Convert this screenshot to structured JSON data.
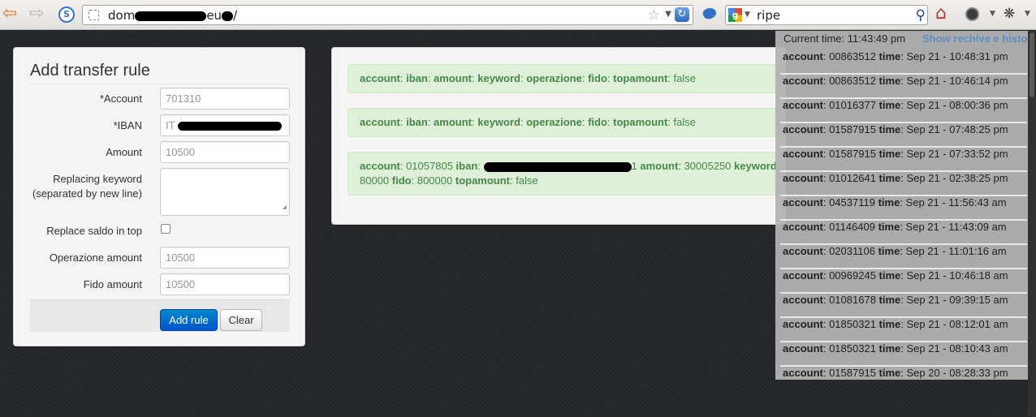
{
  "browser": {
    "url_visible_start": "dom",
    "url_visible_middle": "eu",
    "url_visible_end": "/",
    "search_query": "ripe"
  },
  "form": {
    "title": "Add transfer rule",
    "fields": [
      {
        "label": "*Account",
        "value": "701310",
        "kind": "input"
      },
      {
        "label": "*IBAN",
        "value": "IT",
        "kind": "input"
      },
      {
        "label": "Amount",
        "value": "10500",
        "kind": "input"
      },
      {
        "label_line1": "Replacing keyword",
        "label_line2": "(separated by new line)",
        "value": "",
        "kind": "textarea"
      },
      {
        "label": "Replace saldo in top",
        "checked": false,
        "kind": "checkbox"
      },
      {
        "label": "Operazione amount",
        "value": "10500",
        "kind": "input"
      },
      {
        "label": "Fido amount",
        "value": "10500",
        "kind": "input"
      }
    ],
    "add_button": "Add rule",
    "clear_button": "Clear"
  },
  "rules": [
    {
      "account": "",
      "iban": "",
      "amount": "",
      "keyword": "",
      "operazione": "",
      "fido": "",
      "topamount": "false"
    },
    {
      "account": "",
      "iban": "",
      "amount": "",
      "keyword": "",
      "operazione": "",
      "fido": "",
      "topamount": "false"
    },
    {
      "account": "01057805",
      "iban_suffix": "1",
      "amount": "30005250",
      "keyword_partial": "",
      "operazione_partial": "80000",
      "fido": "800000",
      "topamount": "false"
    }
  ],
  "labels": {
    "account": "account",
    "iban": "iban",
    "amount": "amount",
    "keyword": "keyword",
    "operazione": "operazione",
    "fido": "fido",
    "topamount": "topamount",
    "time": "time",
    "sep": ": "
  },
  "history": {
    "current_time_label": "Current time: 11:43:49 pm",
    "show_link": "Show rechive e history",
    "items": [
      {
        "account": "00863512",
        "time": "Sep 21 - 10:48:31 pm"
      },
      {
        "account": "00863512",
        "time": "Sep 21 - 10:46:14 pm"
      },
      {
        "account": "01016377",
        "time": "Sep 21 - 08:00:36 pm"
      },
      {
        "account": "01587915",
        "time": "Sep 21 - 07:48:25 pm"
      },
      {
        "account": "01587915",
        "time": "Sep 21 - 07:33:52 pm"
      },
      {
        "account": "01012641",
        "time": "Sep 21 - 02:38:25 pm"
      },
      {
        "account": "04537119",
        "time": "Sep 21 - 11:56:43 am"
      },
      {
        "account": "01146409",
        "time": "Sep 21 - 11:43:09 am"
      },
      {
        "account": "02031106",
        "time": "Sep 21 - 11:01:16 am"
      },
      {
        "account": "00969245",
        "time": "Sep 21 - 10:46:18 am"
      },
      {
        "account": "01081678",
        "time": "Sep 21 - 09:39:15 am"
      },
      {
        "account": "01850321",
        "time": "Sep 21 - 08:12:01 am"
      },
      {
        "account": "01850321",
        "time": "Sep 21 - 08:10:43 am"
      },
      {
        "account": "01587915",
        "time": "Sep 20 - 08:28:33 pm"
      }
    ]
  }
}
